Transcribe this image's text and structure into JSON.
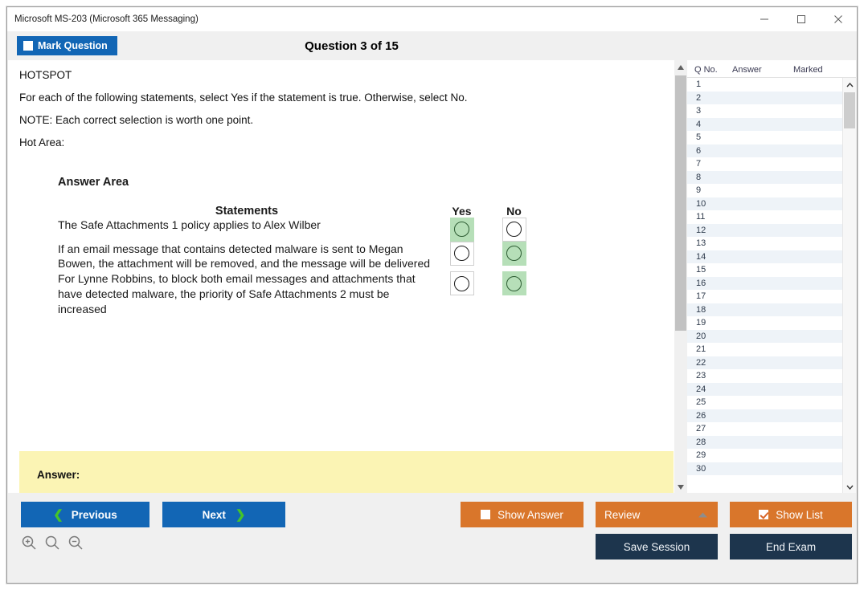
{
  "window": {
    "title": "Microsoft MS-203 (Microsoft 365 Messaging)",
    "minimize_label": "Minimize",
    "maximize_label": "Maximize",
    "close_label": "Close"
  },
  "header": {
    "mark_question_label": "Mark Question",
    "mark_question_checked": false,
    "question_counter": "Question 3 of 15"
  },
  "question": {
    "type_label": "HOTSPOT",
    "instruction": "For each of the following statements, select Yes if the statement is true. Otherwise, select No.",
    "note": "NOTE: Each correct selection is worth one point.",
    "hot_area_label": "Hot Area:",
    "answer_area_label": "Answer Area",
    "columns": {
      "statements": "Statements",
      "yes": "Yes",
      "no": "No"
    },
    "statements": [
      {
        "text": "The Safe Attachments 1 policy applies to Alex Wilber",
        "selected": "yes"
      },
      {
        "text": "If an email message that contains detected malware is sent to Megan Bowen, the attachment will be removed, and the message will be delivered",
        "selected": "no"
      },
      {
        "text": "For Lynne Robbins, to block both email messages and attachments that have detected malware, the priority of Safe Attachments 2 must be increased",
        "selected": "no"
      }
    ]
  },
  "answer_panel": {
    "label": "Answer:",
    "background_color": "#fbf4b4"
  },
  "question_list": {
    "columns": [
      "Q No.",
      "Answer",
      "Marked"
    ],
    "rows": [
      {
        "no": "1",
        "answer": "",
        "marked": ""
      },
      {
        "no": "2",
        "answer": "",
        "marked": ""
      },
      {
        "no": "3",
        "answer": "",
        "marked": ""
      },
      {
        "no": "4",
        "answer": "",
        "marked": ""
      },
      {
        "no": "5",
        "answer": "",
        "marked": ""
      },
      {
        "no": "6",
        "answer": "",
        "marked": ""
      },
      {
        "no": "7",
        "answer": "",
        "marked": ""
      },
      {
        "no": "8",
        "answer": "",
        "marked": ""
      },
      {
        "no": "9",
        "answer": "",
        "marked": ""
      },
      {
        "no": "10",
        "answer": "",
        "marked": ""
      },
      {
        "no": "11",
        "answer": "",
        "marked": ""
      },
      {
        "no": "12",
        "answer": "",
        "marked": ""
      },
      {
        "no": "13",
        "answer": "",
        "marked": ""
      },
      {
        "no": "14",
        "answer": "",
        "marked": ""
      },
      {
        "no": "15",
        "answer": "",
        "marked": ""
      },
      {
        "no": "16",
        "answer": "",
        "marked": ""
      },
      {
        "no": "17",
        "answer": "",
        "marked": ""
      },
      {
        "no": "18",
        "answer": "",
        "marked": ""
      },
      {
        "no": "19",
        "answer": "",
        "marked": ""
      },
      {
        "no": "20",
        "answer": "",
        "marked": ""
      },
      {
        "no": "21",
        "answer": "",
        "marked": ""
      },
      {
        "no": "22",
        "answer": "",
        "marked": ""
      },
      {
        "no": "23",
        "answer": "",
        "marked": ""
      },
      {
        "no": "24",
        "answer": "",
        "marked": ""
      },
      {
        "no": "25",
        "answer": "",
        "marked": ""
      },
      {
        "no": "26",
        "answer": "",
        "marked": ""
      },
      {
        "no": "27",
        "answer": "",
        "marked": ""
      },
      {
        "no": "28",
        "answer": "",
        "marked": ""
      },
      {
        "no": "29",
        "answer": "",
        "marked": ""
      },
      {
        "no": "30",
        "answer": "",
        "marked": ""
      }
    ]
  },
  "footer": {
    "previous_label": "Previous",
    "previous_chevron": "❮",
    "next_label": "Next",
    "next_chevron": "❯",
    "show_answer_label": "Show Answer",
    "show_answer_checked": false,
    "review_label": "Review",
    "show_list_label": "Show List",
    "show_list_checked": true,
    "save_session_label": "Save Session",
    "end_exam_label": "End Exam"
  },
  "colors": {
    "primary_blue": "#1266b5",
    "orange": "#d9762b",
    "dark_navy": "#1d354d",
    "green_selected": "#b6dfb8",
    "chevron_green": "#45c42a"
  }
}
